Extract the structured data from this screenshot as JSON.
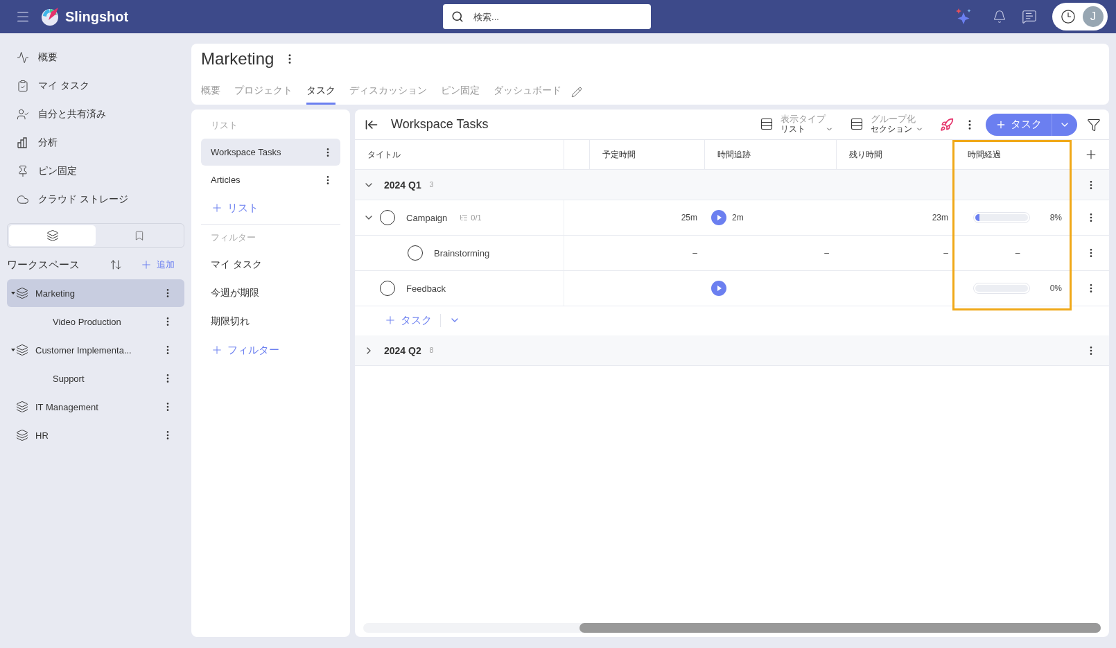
{
  "topbar": {
    "brand": "Slingshot",
    "search": {
      "placeholder": "検索..."
    },
    "avatar": "J"
  },
  "nav": [
    {
      "kind": "overview",
      "label": "概要"
    },
    {
      "kind": "tasks",
      "label": "マイ タスク"
    },
    {
      "kind": "shared",
      "label": "自分と共有済み"
    },
    {
      "kind": "analytics",
      "label": "分析"
    },
    {
      "kind": "pinned",
      "label": "ピン固定"
    },
    {
      "kind": "cloud",
      "label": "クラウド ストレージ"
    }
  ],
  "workspace_switch": [
    {
      "kind": "workspaces",
      "selected": true
    },
    {
      "kind": "bookmarks",
      "selected": false
    }
  ],
  "workspaces": {
    "title": "ワークスペース",
    "add": "追加",
    "items": [
      {
        "name": "Marketing",
        "selected": true,
        "expanded": true,
        "children": [
          {
            "name": "Video Production",
            "selected": false
          }
        ]
      },
      {
        "name": "Customer Implementa...",
        "selected": false,
        "expanded": true,
        "children": [
          {
            "name": "Support",
            "selected": false
          }
        ]
      },
      {
        "name": "IT Management",
        "selected": false
      },
      {
        "name": "HR",
        "selected": false
      }
    ]
  },
  "header": {
    "title": "Marketing",
    "tabs": [
      {
        "label": "概要",
        "selected": false
      },
      {
        "label": "プロジェクト",
        "selected": false
      },
      {
        "label": "タスク",
        "selected": true
      },
      {
        "label": "ディスカッション",
        "selected": false
      },
      {
        "label": "ピン固定",
        "selected": false
      },
      {
        "label": "ダッシュボード",
        "selected": false
      }
    ]
  },
  "lists_panel": {
    "lists_title": "リスト",
    "lists": [
      {
        "label": "Workspace Tasks",
        "selected": true
      },
      {
        "label": "Articles",
        "selected": false
      }
    ],
    "add_list": "リスト",
    "filters_title": "フィルター",
    "filters": [
      {
        "label": "マイ タスク",
        "selected": false
      },
      {
        "label": "今週が期限",
        "selected": false
      },
      {
        "label": "期限切れ",
        "selected": false
      }
    ],
    "add_filter": "フィルター"
  },
  "tasks": {
    "title": "Workspace Tasks",
    "view_type": {
      "label": "表示タイプ",
      "value": "リスト"
    },
    "grouping": {
      "label": "グループ化",
      "value": "セクション"
    },
    "add_button": "タスク",
    "columns": [
      "タイトル",
      "予定時間",
      "時間追跡",
      "残り時間",
      "時間経過"
    ],
    "groups": [
      {
        "name": "2024 Q1",
        "count": "3",
        "expanded": true,
        "add_task": "タスク",
        "tasks": [
          {
            "title": "Campaign",
            "done": false,
            "expanded": true,
            "subtasks": "0/1",
            "estimate": "25m",
            "timer": true,
            "tracked": "2m",
            "remaining": "23m",
            "elapsed": {
              "level": 0.08,
              "reading": "8%"
            },
            "children": [
              {
                "title": "Brainstorming",
                "done": false,
                "estimate": "–",
                "timer": false,
                "tracked": "–",
                "remaining": "–",
                "elapsed": {
                  "reading": "–"
                }
              }
            ]
          },
          {
            "title": "Feedback",
            "done": false,
            "timer": true,
            "elapsed": {
              "level": 0,
              "reading": "0%"
            }
          }
        ]
      },
      {
        "name": "2024 Q2",
        "count": "8",
        "expanded": false
      }
    ]
  }
}
